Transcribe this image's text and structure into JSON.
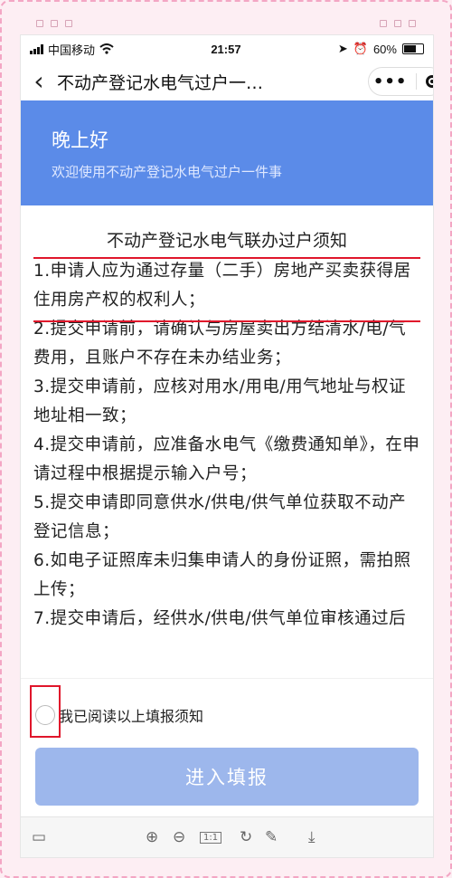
{
  "status_bar": {
    "carrier": "中国移动",
    "wifi_icon": "wifi-icon",
    "time": "21:57",
    "battery": "60%"
  },
  "nav": {
    "back_icon": "chevron-left-icon",
    "title": "不动产登记水电气过户一…",
    "more_icon": "more-dots-icon",
    "close_icon": "target-close-icon"
  },
  "banner": {
    "greeting": "晚上好",
    "welcome": "欢迎使用不动产登记水电气过户一件事",
    "color": "#5b8be8"
  },
  "notice": {
    "title": "不动产登记水电气联办过户须知",
    "items": [
      "1.申请人应为通过存量（二手）房地产买卖获得居住用房产权的权利人；",
      "2.提交申请前，请确认与房屋卖出方结清水/电/气费用，且账户不存在未办结业务；",
      "3.提交申请前，应核对用水/用电/用气地址与权证地址相一致；",
      "4.提交申请前，应准备水电气《缴费通知单》，在申请过程中根据提示输入户号；",
      "5.提交申请即同意供水/供电/供气单位获取不动产登记信息；",
      "6.如电子证照库未归集申请人的身份证照，需拍照上传；",
      "7.提交申请后，经供水/供电/供气单位审核通过后过户。"
    ]
  },
  "agreement": {
    "label": "我已阅读以上填报须知"
  },
  "enter_button": {
    "label": "进入填报",
    "color": "#9db7ec"
  },
  "toolbar": {
    "icons": [
      "layout-icon",
      "zoom-in-icon",
      "zoom-out-icon",
      "actual-size-icon",
      "rotate-icon",
      "edit-icon",
      "download-icon"
    ],
    "actual_size_label": "1:1"
  },
  "annotation_color": "#e0162b"
}
